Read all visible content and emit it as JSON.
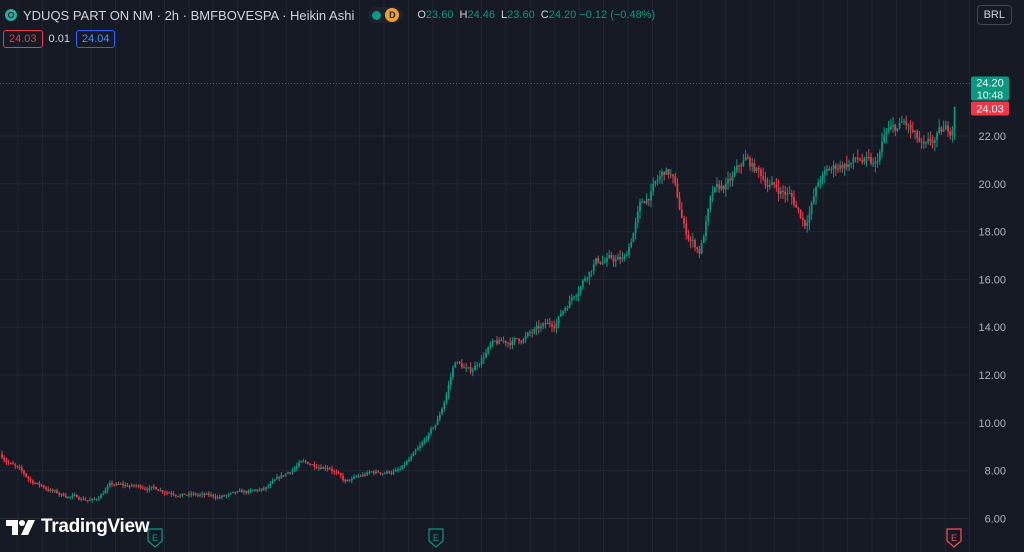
{
  "header": {
    "title": "YDUQS PART ON NM · 2h · BMFBOVESPA · Heikin Ashi",
    "badge_letter": "D",
    "ohlc": [
      {
        "key": "O",
        "value": "23.60"
      },
      {
        "key": "H",
        "value": "24.46"
      },
      {
        "key": "L",
        "value": "23.60"
      },
      {
        "key": "C",
        "value": "24.20 −0.12 (−0.48%)"
      }
    ]
  },
  "trade": {
    "sell": "24.03",
    "spread": "0.01",
    "buy": "24.04"
  },
  "currency": "BRL",
  "price_labels": {
    "last": "24.20",
    "countdown": "10:48",
    "bid": "24.03"
  },
  "branding": "TradingView",
  "earnings_markers": [
    "E",
    "E",
    "E"
  ],
  "colors": {
    "up": "#089981",
    "down": "#f23645",
    "background": "#161a25",
    "grid": "#232632"
  },
  "chart_data": {
    "type": "candlestick",
    "yticks": [
      "6.00",
      "8.00",
      "10.00",
      "12.00",
      "14.00",
      "16.00",
      "18.00",
      "20.00",
      "22.00"
    ],
    "ylim": [
      5.6,
      25.6
    ],
    "anchors": [
      [
        0,
        8.7
      ],
      [
        30,
        7.6
      ],
      [
        60,
        7.0
      ],
      [
        95,
        6.75
      ],
      [
        110,
        7.4
      ],
      [
        150,
        7.3
      ],
      [
        185,
        7.0
      ],
      [
        220,
        6.9
      ],
      [
        265,
        7.2
      ],
      [
        300,
        8.3
      ],
      [
        330,
        8.2
      ],
      [
        345,
        7.5
      ],
      [
        370,
        7.9
      ],
      [
        400,
        8.0
      ],
      [
        420,
        8.9
      ],
      [
        437,
        10.0
      ],
      [
        445,
        11.0
      ],
      [
        455,
        12.6
      ],
      [
        470,
        12.1
      ],
      [
        490,
        13.2
      ],
      [
        520,
        13.5
      ],
      [
        555,
        14.2
      ],
      [
        575,
        15.5
      ],
      [
        595,
        16.8
      ],
      [
        625,
        16.8
      ],
      [
        640,
        19.0
      ],
      [
        665,
        20.5
      ],
      [
        672,
        20.3
      ],
      [
        685,
        18.0
      ],
      [
        700,
        17.2
      ],
      [
        712,
        19.5
      ],
      [
        730,
        20.0
      ],
      [
        745,
        21.0
      ],
      [
        770,
        20.0
      ],
      [
        790,
        19.5
      ],
      [
        805,
        18.4
      ],
      [
        820,
        20.2
      ],
      [
        840,
        20.8
      ],
      [
        860,
        21.0
      ],
      [
        875,
        20.6
      ],
      [
        885,
        22.0
      ],
      [
        905,
        22.5
      ],
      [
        925,
        21.3
      ],
      [
        940,
        22.0
      ],
      [
        952,
        22.3
      ],
      [
        956,
        24.2
      ]
    ]
  }
}
